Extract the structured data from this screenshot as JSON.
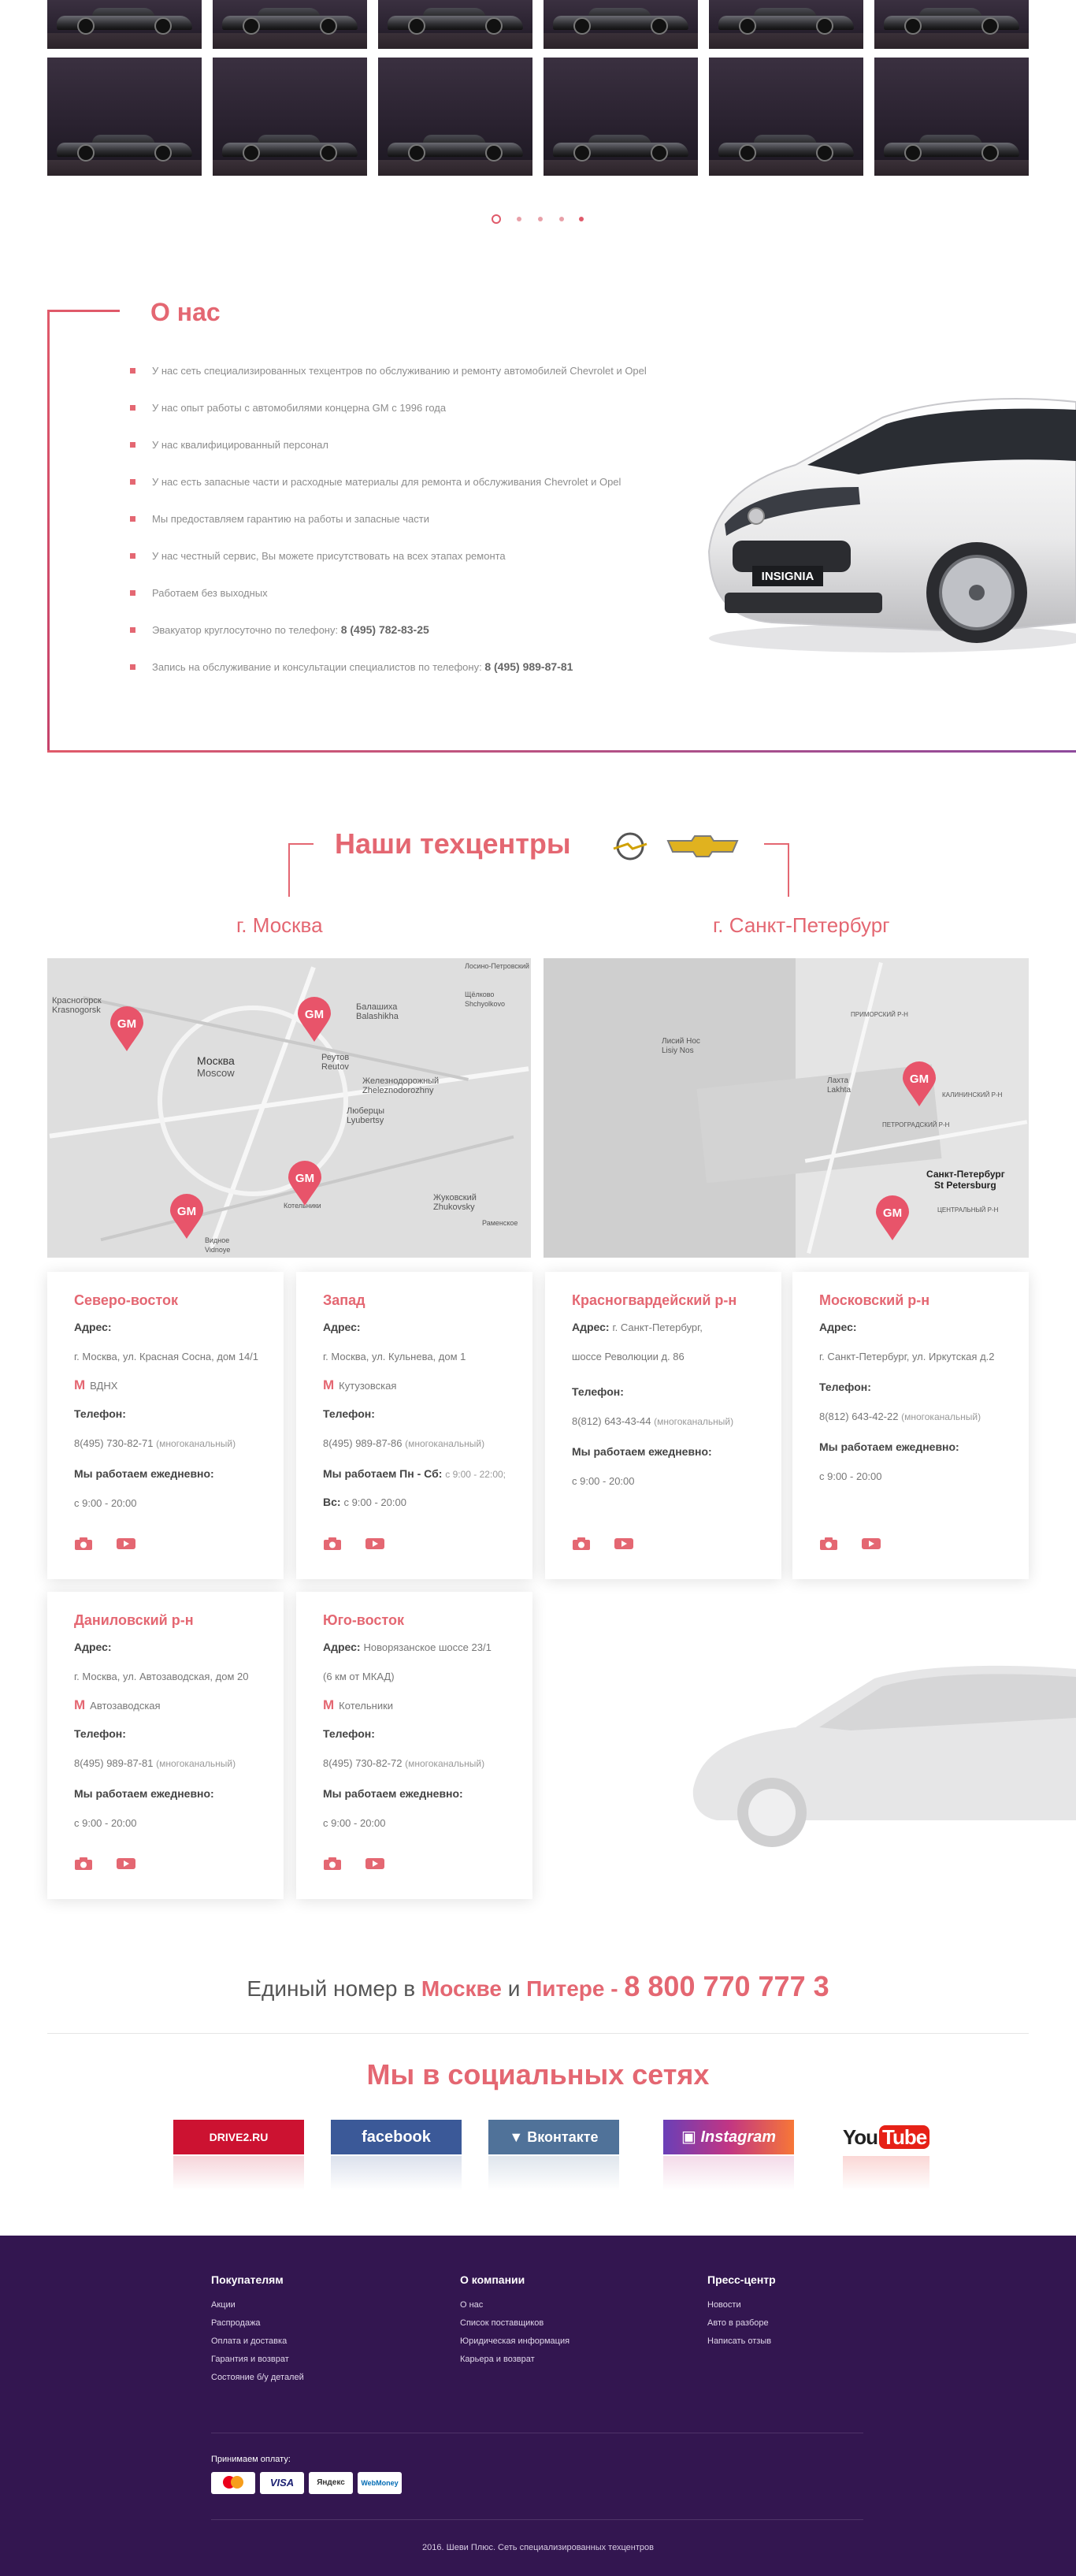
{
  "gallery": {
    "rows": 2,
    "cols": 6,
    "dots": 5,
    "active_dot": 0
  },
  "about": {
    "title": "О нас",
    "items": [
      {
        "text": "У нас сеть специализированных техцентров по обслуживанию и ремонту автомобилей Chevrolet и Opel",
        "phone": ""
      },
      {
        "text": "У нас опыт работы с автомобилями концерна GM с 1996 года",
        "phone": ""
      },
      {
        "text": "У нас квалифицированный персонал",
        "phone": ""
      },
      {
        "text": "У нас есть запасные части и расходные материалы для ремонта и обслуживания Chevrolet и Opel",
        "phone": ""
      },
      {
        "text": "Мы предоставляем гарантию на работы и запасные части",
        "phone": ""
      },
      {
        "text": "У нас честный сервис, Вы можете присутствовать на всех этапах ремонта",
        "phone": ""
      },
      {
        "text": "Работаем без выходных",
        "phone": ""
      },
      {
        "text": "Эвакуатор круглосуточно по телефону: ",
        "phone": "8 (495) 782-83-25"
      },
      {
        "text": "Запись на обслуживание и консультации специалистов по телефону: ",
        "phone": "8 (495) 989-87-81"
      }
    ],
    "car_plate": "INSIGNIA"
  },
  "centers": {
    "title": "Наши техцентры",
    "city_moscow": "г. Москва",
    "city_spb": "г. Санкт-Петербург",
    "map_moscow_labels": [
      "Красногорск",
      "Krasnogorsk",
      "Москва",
      "Moscow",
      "Балашиха",
      "Balashikha",
      "Реутов",
      "Reutov",
      "Железнодорожный",
      "Zheleznodorozhny",
      "Люберцы",
      "Lyubertsy",
      "Жуковский",
      "Zhukovsky",
      "Лосино-Петровский",
      "Щёлково",
      "Shchyolkovo",
      "Котельники",
      "Видное",
      "Vidnoye",
      "Раменское"
    ],
    "map_spb_labels": [
      "Лахта",
      "Lakhta",
      "Санкт-Петербург",
      "St Petersburg",
      "ПРИМОРСКИЙ Р-Н",
      "КАЛИНИНСКИЙ Р-Н",
      "ПЕТРОГРАДСКИЙ Р-Н",
      "ЦЕНТРАЛЬНЫЙ Р-Н",
      "Лисий Нос",
      "Lisiy Nos"
    ],
    "labels": {
      "address": "Адрес:",
      "phone": "Телефон:",
      "hours_daily": "Мы работаем ежедневно:",
      "hours_weekdays": "Мы работаем Пн - Сб:",
      "sunday": "Вс:"
    },
    "cards": [
      {
        "name": "Северо-восток",
        "address": "г. Москва, ул. Красная Сосна, дом 14/1",
        "metro": "ВДНХ",
        "phone": "8(495) 730-82-71",
        "phone_note": "(многоканальный)",
        "hours": "с 9:00 - 20:00"
      },
      {
        "name": "Запад",
        "address": "г. Москва, ул. Кульнева, дом 1",
        "metro": "Кутузовская",
        "phone": "8(495) 989-87-86",
        "phone_note": "(многоканальный)",
        "hours": "с 9:00 - 22:00;",
        "sunday_hours": "с 9:00 - 20:00"
      },
      {
        "name": "Красногвардейский р-н",
        "address": "г. Санкт-Петербург,",
        "address2": "шоссе Революции д. 86",
        "phone": "8(812) 643-43-44",
        "phone_note": "(многоканальный)",
        "hours": "с 9:00 - 20:00"
      },
      {
        "name": "Московский р-н",
        "address": "г. Санкт-Петербург, ул. Иркутская д.2",
        "phone": "8(812) 643-42-22",
        "phone_note": "(многоканальный)",
        "hours": "с 9:00 - 20:00"
      },
      {
        "name": "Даниловский р-н",
        "address": "г. Москва, ул. Автозаводская, дом 20",
        "metro": "Автозаводская",
        "phone": "8(495) 989-87-81",
        "phone_note": "(многоканальный)",
        "hours": "с 9:00 - 20:00"
      },
      {
        "name": "Юго-восток",
        "address": "Новорязанское шоссе 23/1",
        "address2": "(6 км от МКАД)",
        "metro": "Котельники",
        "phone": "8(495) 730-82-72",
        "phone_note": "(многоканальный)",
        "hours": "с 9:00 - 20:00"
      }
    ]
  },
  "hotline": {
    "prefix": "Единый номер в ",
    "city1": "Москве",
    "and": " и ",
    "city2": "Питере",
    "dash": " - ",
    "number": "8 800 770 777 3"
  },
  "social": {
    "title": "Мы в социальных сетях",
    "buttons": [
      {
        "label": "DRIVE2.RU",
        "color": "#cc1231"
      },
      {
        "label": "facebook",
        "color": "#3b5998"
      },
      {
        "label": "Вконтакте",
        "color": "#507299"
      },
      {
        "label": "Instagram",
        "color": "#c13584"
      },
      {
        "label_you": "You",
        "label_tube": "Tube",
        "color": "#e62117"
      }
    ]
  },
  "footer": {
    "bg": "#331650",
    "columns": [
      {
        "heading": "Покупателям",
        "items": [
          "Акции",
          "Распродажа",
          "Оплата и доставка",
          "Гарантия и возврат",
          "Состояние б/у деталей"
        ]
      },
      {
        "heading": "О компании",
        "items": [
          "О нас",
          "Список поставщиков",
          "Юридическая информация",
          "Карьера и возврат"
        ]
      },
      {
        "heading": "Пресс-центр",
        "items": [
          "Новости",
          "Авто в разборе",
          "Написать отзыв"
        ]
      }
    ],
    "payment_label": "Принимаем оплату:",
    "payments": [
      "MasterCard",
      "VISA",
      "Яндекс",
      "WebMoney"
    ],
    "copyright": "2016. Шеви Плюс. Сеть специализированных техцентров"
  },
  "colors": {
    "accent": "#e46772",
    "footer": "#331650"
  }
}
